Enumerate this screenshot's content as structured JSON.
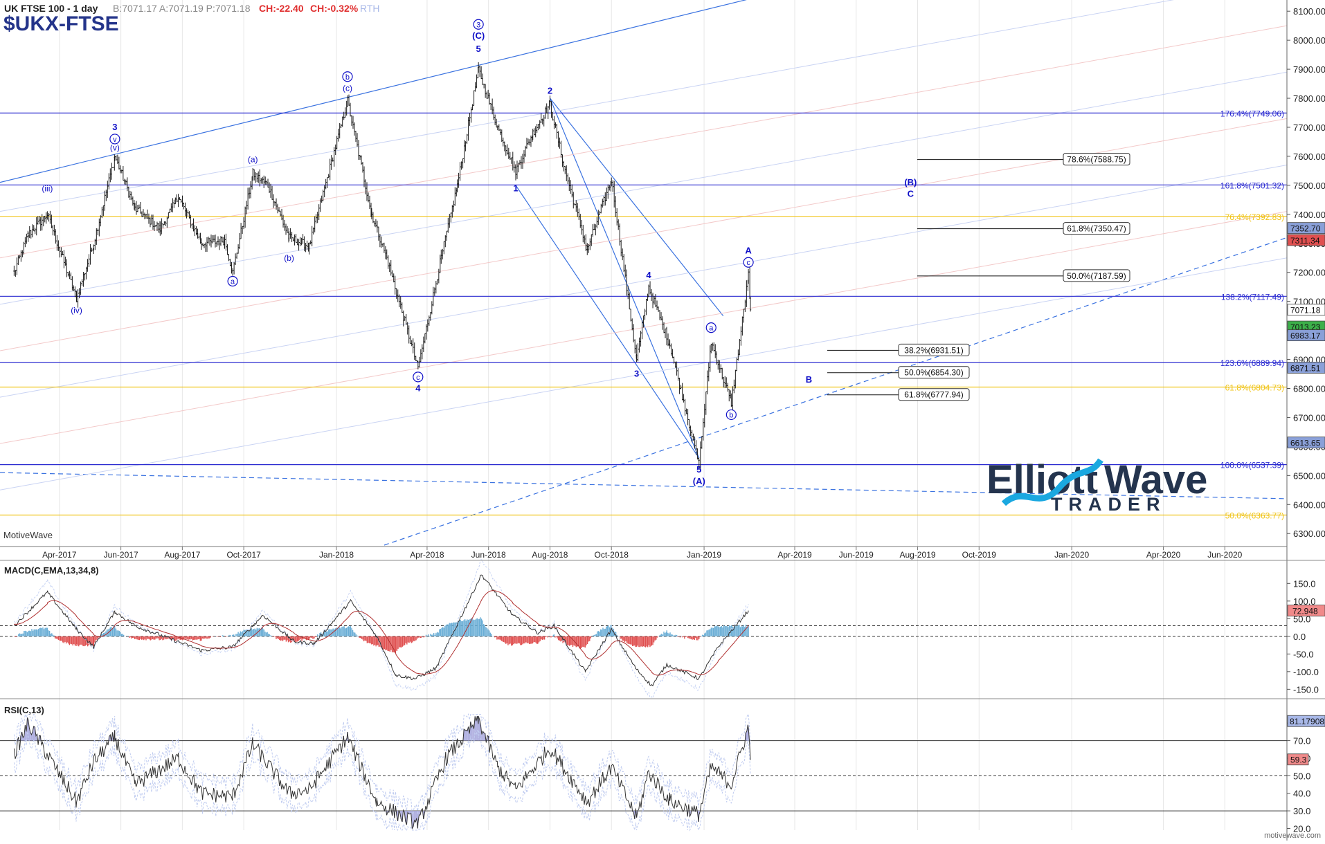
{
  "header": {
    "symbol_title": "UK FTSE 100 - 1 day",
    "quote": "B:7071.17 A:7071.19 P:7071.18",
    "change_abs": "CH:-22.40",
    "change_pct": "CH:-0.32%",
    "session": "RTH",
    "ticker": "$UKX-FTSE"
  },
  "branding": {
    "platform": "MotiveWave",
    "watermark_url": "motivewave.com",
    "logo_word1": "Elliott",
    "logo_word2": "Wave",
    "logo_word3": "TRADER"
  },
  "colors": {
    "price_bar": "#1a1a1a",
    "wave_label": "#1010c8",
    "fib_blue": "#2a2ad0",
    "fib_gold": "#f0c419",
    "trend_blue": "#3a72e0",
    "macd_pos": "#6aaed6",
    "macd_neg": "#e05050",
    "rsi_fill": "#b0b0e0",
    "logo_dark": "#24344e",
    "logo_accent": "#1aa8e0"
  },
  "chart_data": [
    {
      "type": "candlestick",
      "title": "UK FTSE 100 - 1 day",
      "y_axis_ticks": [
        6300,
        6400,
        6500,
        6600,
        6700,
        6800,
        6900,
        7000,
        7100,
        7200,
        7300,
        7400,
        7500,
        7600,
        7700,
        7800,
        7900,
        8000,
        8100
      ],
      "y_tick_labels": [
        "6300.00",
        "6400.00",
        "6500.00",
        "6600.00",
        "6700.00",
        "6800.00",
        "6900.00",
        "7000.00",
        "7100.00",
        "7200.00",
        "7300.00",
        "7400.00",
        "7500.00",
        "7600.00",
        "7700.00",
        "7800.00",
        "7900.00",
        "8000.00",
        "8100.00"
      ],
      "ylim": [
        6260,
        8130
      ],
      "x_axis_labels": [
        "Apr-2017",
        "Jun-2017",
        "Aug-2017",
        "Oct-2017",
        "Jan-2018",
        "Apr-2018",
        "Jun-2018",
        "Aug-2018",
        "Oct-2018",
        "Jan-2019",
        "Apr-2019",
        "Jun-2019",
        "Aug-2019",
        "Oct-2019",
        "Jan-2020",
        "Apr-2020",
        "Jun-2020"
      ],
      "price_path_key_points": [
        {
          "date": "2017-02-15",
          "value": 7200
        },
        {
          "date": "2017-03-01",
          "value": 7330
        },
        {
          "date": "2017-03-20",
          "value": 7400
        },
        {
          "date": "2017-04-18",
          "value": 7110
        },
        {
          "date": "2017-05-05",
          "value": 7300
        },
        {
          "date": "2017-05-26",
          "value": 7600
        },
        {
          "date": "2017-06-15",
          "value": 7420
        },
        {
          "date": "2017-07-10",
          "value": 7350
        },
        {
          "date": "2017-07-28",
          "value": 7460
        },
        {
          "date": "2017-08-20",
          "value": 7300
        },
        {
          "date": "2017-09-12",
          "value": 7310
        },
        {
          "date": "2017-09-20",
          "value": 7200
        },
        {
          "date": "2017-10-10",
          "value": 7540
        },
        {
          "date": "2017-10-25",
          "value": 7500
        },
        {
          "date": "2017-11-15",
          "value": 7320
        },
        {
          "date": "2017-12-05",
          "value": 7290
        },
        {
          "date": "2018-01-12",
          "value": 7790
        },
        {
          "date": "2018-02-05",
          "value": 7400
        },
        {
          "date": "2018-02-20",
          "value": 7250
        },
        {
          "date": "2018-03-23",
          "value": 6870
        },
        {
          "date": "2018-04-15",
          "value": 7250
        },
        {
          "date": "2018-05-01",
          "value": 7500
        },
        {
          "date": "2018-05-22",
          "value": 7900
        },
        {
          "date": "2018-06-10",
          "value": 7700
        },
        {
          "date": "2018-06-28",
          "value": 7550
        },
        {
          "date": "2018-07-15",
          "value": 7680
        },
        {
          "date": "2018-08-01",
          "value": 7780
        },
        {
          "date": "2018-08-16",
          "value": 7550
        },
        {
          "date": "2018-09-07",
          "value": 7280
        },
        {
          "date": "2018-10-01",
          "value": 7520
        },
        {
          "date": "2018-10-26",
          "value": 6900
        },
        {
          "date": "2018-11-07",
          "value": 7150
        },
        {
          "date": "2018-11-28",
          "value": 6950
        },
        {
          "date": "2018-12-27",
          "value": 6540
        },
        {
          "date": "2019-01-08",
          "value": 6960
        },
        {
          "date": "2019-01-28",
          "value": 6750
        },
        {
          "date": "2019-02-14",
          "value": 7190
        },
        {
          "date": "2019-02-16",
          "value": 7071
        }
      ],
      "last_price": 7071.18,
      "price_tags": [
        {
          "label": "7352.70",
          "value": 7352.7,
          "bg": "#8aa0d8"
        },
        {
          "label": "7311.34",
          "value": 7311.34,
          "bg": "#e05050"
        },
        {
          "label": "7071.18",
          "value": 7071.18,
          "bg": "#ffffff"
        },
        {
          "label": "7013.23",
          "value": 7013.23,
          "bg": "#3cb04a"
        },
        {
          "label": "6983.17",
          "value": 6983.17,
          "bg": "#8aa0d8"
        },
        {
          "label": "6871.51",
          "value": 6871.51,
          "bg": "#8aa0d8"
        },
        {
          "label": "6613.65",
          "value": 6613.65,
          "bg": "#8aa0d8"
        }
      ],
      "fib_levels": [
        {
          "label": "176.4%(7749.06)",
          "value": 7749.06,
          "color": "blue"
        },
        {
          "label": "161.8%(7501.32)",
          "value": 7501.32,
          "color": "blue"
        },
        {
          "label": "76.4%(7392.83)",
          "value": 7392.83,
          "color": "gold"
        },
        {
          "label": "138.2%(7117.49)",
          "value": 7117.49,
          "color": "blue"
        },
        {
          "label": "123.6%(6889.94)",
          "value": 6889.94,
          "color": "blue"
        },
        {
          "label": "61.8%(6804.73)",
          "value": 6804.73,
          "color": "gold"
        },
        {
          "label": "100.0%(6537.39)",
          "value": 6537.39,
          "color": "blue"
        },
        {
          "label": "50.0%(6363.77)",
          "value": 6363.77,
          "color": "gold"
        }
      ],
      "retracement_boxes": [
        {
          "label": "78.6%(7588.75)",
          "value": 7588.75
        },
        {
          "label": "61.8%(7350.47)",
          "value": 7350.47
        },
        {
          "label": "50.0%(7187.59)",
          "value": 7187.59
        },
        {
          "label": "38.2%(6931.51)",
          "value": 6931.51
        },
        {
          "label": "50.0%(6854.30)",
          "value": 6854.3
        },
        {
          "label": "61.8%(6777.94)",
          "value": 6777.94
        }
      ],
      "wave_labels": [
        {
          "text": "3",
          "date": "2017-05-26",
          "value": 7690
        },
        {
          "text": "v",
          "date": "2017-05-26",
          "value": 7650,
          "circled": true
        },
        {
          "text": "(v)",
          "date": "2017-05-26",
          "value": 7620
        },
        {
          "text": "(iii)",
          "date": "2017-03-20",
          "value": 7480
        },
        {
          "text": "(iv)",
          "date": "2017-04-18",
          "value": 7060
        },
        {
          "text": "(a)",
          "date": "2017-10-10",
          "value": 7580
        },
        {
          "text": "a",
          "date": "2017-09-20",
          "value": 7160,
          "circled": true
        },
        {
          "text": "(b)",
          "date": "2017-11-15",
          "value": 7240
        },
        {
          "text": "b",
          "date": "2018-01-12",
          "value": 7865,
          "circled": true
        },
        {
          "text": "(c)",
          "date": "2018-01-12",
          "value": 7825
        },
        {
          "text": "c",
          "date": "2018-03-23",
          "value": 6830,
          "circled": true
        },
        {
          "text": "4",
          "date": "2018-03-23",
          "value": 6790
        },
        {
          "text": "3",
          "date": "2018-05-22",
          "value": 8045,
          "circled": true
        },
        {
          "text": "(C)",
          "date": "2018-05-22",
          "value": 8005
        },
        {
          "text": "5",
          "date": "2018-05-22",
          "value": 7960
        },
        {
          "text": "1",
          "date": "2018-06-28",
          "value": 7480
        },
        {
          "text": "2",
          "date": "2018-08-01",
          "value": 7815
        },
        {
          "text": "3",
          "date": "2018-10-26",
          "value": 6840
        },
        {
          "text": "4",
          "date": "2018-11-07",
          "value": 7180
        },
        {
          "text": "5",
          "date": "2018-12-27",
          "value": 6510
        },
        {
          "text": "(A)",
          "date": "2018-12-27",
          "value": 6470
        },
        {
          "text": "a",
          "date": "2019-01-08",
          "value": 7000,
          "circled": true
        },
        {
          "text": "b",
          "date": "2019-01-28",
          "value": 6700,
          "circled": true
        },
        {
          "text": "A",
          "date": "2019-02-14",
          "value": 7265
        },
        {
          "text": "c",
          "date": "2019-02-14",
          "value": 7225,
          "circled": true
        },
        {
          "text": "B",
          "date": "2019-04-15",
          "value": 6820
        },
        {
          "text": "(B)",
          "date": "2019-07-25",
          "value": 7500
        },
        {
          "text": "C",
          "date": "2019-07-25",
          "value": 7460
        }
      ]
    },
    {
      "type": "bar",
      "title": "MACD(C,EMA,13,34,8)",
      "y_axis_ticks": [
        150,
        100,
        50,
        0,
        -50,
        -100,
        -150
      ],
      "y_tick_labels": [
        "150.0",
        "100.0",
        "50.0",
        "0.0",
        "-50.0",
        "-100.0",
        "-150.0"
      ],
      "ylim": [
        -170,
        190
      ],
      "last_value_label": "72.948",
      "last_value": 72.948,
      "dashed_levels": [
        30,
        0
      ],
      "macd_key_points": [
        {
          "date": "2017-02-15",
          "value": 30
        },
        {
          "date": "2017-03-20",
          "value": 125
        },
        {
          "date": "2017-04-18",
          "value": 20
        },
        {
          "date": "2017-05-05",
          "value": -30
        },
        {
          "date": "2017-05-26",
          "value": 70
        },
        {
          "date": "2017-06-15",
          "value": 30
        },
        {
          "date": "2017-08-20",
          "value": -40
        },
        {
          "date": "2017-09-20",
          "value": -30
        },
        {
          "date": "2017-10-20",
          "value": 60
        },
        {
          "date": "2017-11-20",
          "value": -15
        },
        {
          "date": "2017-12-10",
          "value": -20
        },
        {
          "date": "2018-01-15",
          "value": 100
        },
        {
          "date": "2018-02-10",
          "value": 0
        },
        {
          "date": "2018-03-01",
          "value": -110
        },
        {
          "date": "2018-03-20",
          "value": -120
        },
        {
          "date": "2018-04-10",
          "value": -90
        },
        {
          "date": "2018-05-25",
          "value": 175
        },
        {
          "date": "2018-06-25",
          "value": 60
        },
        {
          "date": "2018-07-20",
          "value": 10
        },
        {
          "date": "2018-08-05",
          "value": 30
        },
        {
          "date": "2018-09-05",
          "value": -100
        },
        {
          "date": "2018-10-01",
          "value": 20
        },
        {
          "date": "2018-10-25",
          "value": -90
        },
        {
          "date": "2018-11-10",
          "value": -140
        },
        {
          "date": "2018-11-25",
          "value": -80
        },
        {
          "date": "2018-12-27",
          "value": -120
        },
        {
          "date": "2019-01-15",
          "value": -30
        },
        {
          "date": "2019-02-14",
          "value": 73
        }
      ]
    },
    {
      "type": "line",
      "title": "RSI(C,13)",
      "y_axis_ticks": [
        80,
        70,
        60,
        50,
        40,
        30,
        20
      ],
      "y_tick_labels": [
        "80.0",
        "70.0",
        "60.0",
        "50.0",
        "40.0",
        "30.0",
        "20.0"
      ],
      "ylim": [
        18,
        87
      ],
      "ref_lines": [
        70,
        50,
        30
      ],
      "last_value_label": "59.3",
      "last_value": 59.3,
      "band_value_label": "81.17908",
      "band_value": 81.18,
      "rsi_key_points": [
        {
          "date": "2017-02-15",
          "value": 62
        },
        {
          "date": "2017-03-01",
          "value": 80
        },
        {
          "date": "2017-03-20",
          "value": 62
        },
        {
          "date": "2017-04-18",
          "value": 35
        },
        {
          "date": "2017-05-05",
          "value": 58
        },
        {
          "date": "2017-05-26",
          "value": 72
        },
        {
          "date": "2017-06-15",
          "value": 45
        },
        {
          "date": "2017-07-28",
          "value": 60
        },
        {
          "date": "2017-08-20",
          "value": 40
        },
        {
          "date": "2017-09-20",
          "value": 38
        },
        {
          "date": "2017-10-10",
          "value": 68
        },
        {
          "date": "2017-11-15",
          "value": 40
        },
        {
          "date": "2017-12-05",
          "value": 42
        },
        {
          "date": "2018-01-12",
          "value": 72
        },
        {
          "date": "2018-02-10",
          "value": 35
        },
        {
          "date": "2018-03-23",
          "value": 22
        },
        {
          "date": "2018-04-20",
          "value": 60
        },
        {
          "date": "2018-05-22",
          "value": 82
        },
        {
          "date": "2018-06-10",
          "value": 55
        },
        {
          "date": "2018-06-28",
          "value": 42
        },
        {
          "date": "2018-08-01",
          "value": 66
        },
        {
          "date": "2018-09-07",
          "value": 35
        },
        {
          "date": "2018-10-01",
          "value": 55
        },
        {
          "date": "2018-10-26",
          "value": 26
        },
        {
          "date": "2018-11-07",
          "value": 52
        },
        {
          "date": "2018-11-28",
          "value": 36
        },
        {
          "date": "2018-12-27",
          "value": 28
        },
        {
          "date": "2019-01-08",
          "value": 55
        },
        {
          "date": "2019-01-28",
          "value": 45
        },
        {
          "date": "2019-02-14",
          "value": 78
        },
        {
          "date": "2019-02-16",
          "value": 59
        }
      ]
    }
  ]
}
